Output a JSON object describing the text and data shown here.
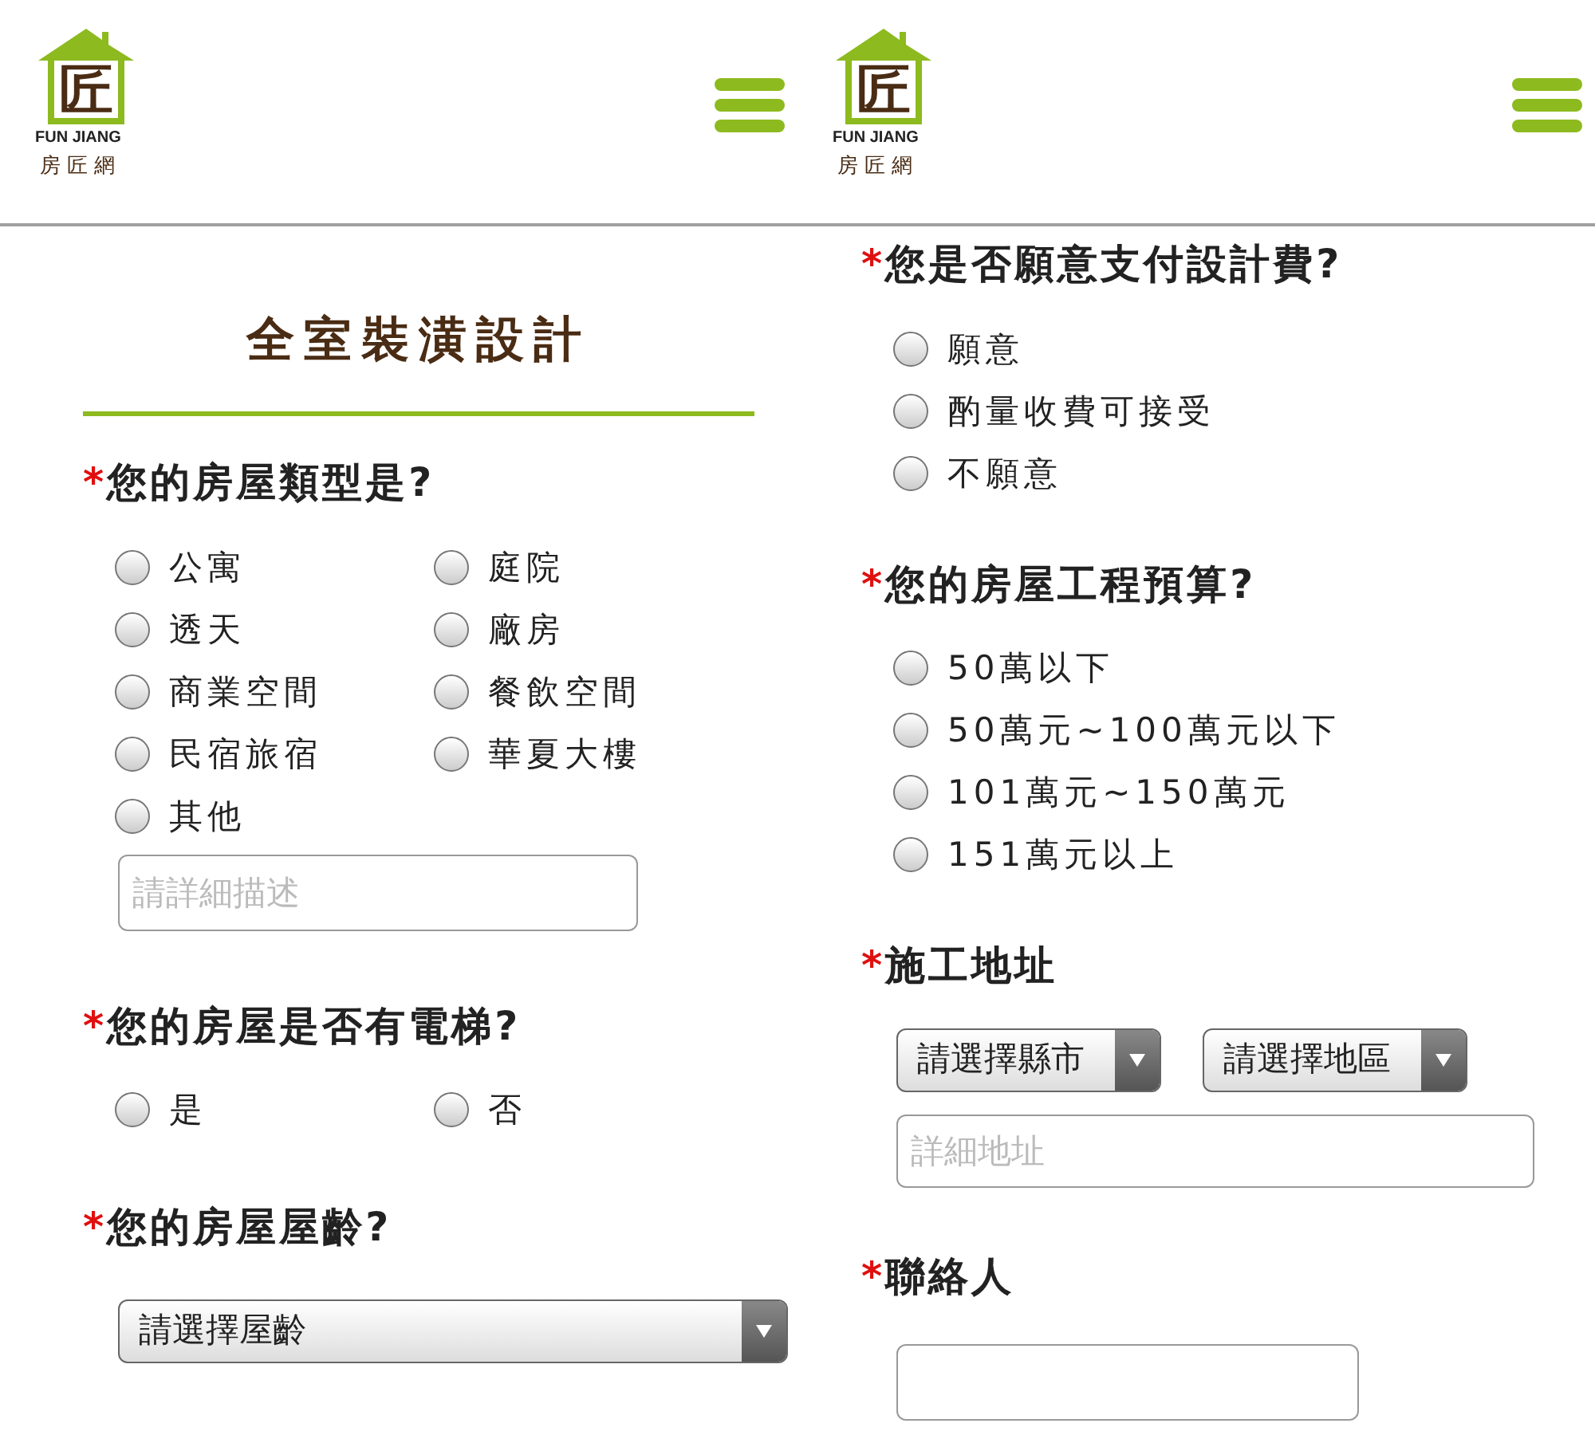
{
  "panels": [
    {
      "header": {
        "logo_char": "匠",
        "logo_en": "FUN JIANG",
        "logo_zh": "房匠網"
      },
      "title": "全室裝潢設計",
      "questions": [
        {
          "label": "您的房屋類型是?",
          "required_mark": "*",
          "fields": [
            {
              "kind": "radio-grid",
              "options": [
                {
                  "label": "公寓",
                  "selected": false
                },
                {
                  "label": "庭院",
                  "selected": false
                },
                {
                  "label": "透天",
                  "selected": false
                },
                {
                  "label": "廠房",
                  "selected": false
                },
                {
                  "label": "商業空間",
                  "selected": false
                },
                {
                  "label": "餐飲空間",
                  "selected": false
                },
                {
                  "label": "民宿旅宿",
                  "selected": false
                },
                {
                  "label": "華夏大樓",
                  "selected": false
                },
                {
                  "label": "其他",
                  "selected": false
                }
              ]
            },
            {
              "kind": "text-input",
              "placeholder": "請詳細描述"
            }
          ]
        },
        {
          "label": "您的房屋是否有電梯?",
          "required_mark": "*",
          "fields": [
            {
              "kind": "radio-grid",
              "options": [
                {
                  "label": "是",
                  "selected": false
                },
                {
                  "label": "否",
                  "selected": false
                }
              ]
            }
          ]
        },
        {
          "label": "您的房屋屋齡?",
          "required_mark": "*",
          "fields": [
            {
              "kind": "select",
              "value": "請選擇屋齡"
            }
          ]
        }
      ]
    },
    {
      "header": {
        "logo_char": "匠",
        "logo_en": "FUN JIANG",
        "logo_zh": "房匠網"
      },
      "questions": [
        {
          "label": "您是否願意支付設計費?",
          "required_mark": "*",
          "fields": [
            {
              "kind": "radio-list",
              "options": [
                {
                  "label": "願意",
                  "selected": false
                },
                {
                  "label": "酌量收費可接受",
                  "selected": false
                },
                {
                  "label": "不願意",
                  "selected": false
                }
              ]
            }
          ]
        },
        {
          "label": "您的房屋工程預算?",
          "required_mark": "*",
          "fields": [
            {
              "kind": "radio-list",
              "options": [
                {
                  "label": "50萬以下",
                  "selected": false
                },
                {
                  "label": "50萬元~100萬元以下",
                  "selected": false
                },
                {
                  "label": "101萬元~150萬元",
                  "selected": false
                },
                {
                  "label": "151萬元以上",
                  "selected": false
                }
              ]
            }
          ]
        },
        {
          "label": "施工地址",
          "required_mark": "*",
          "fields": [
            {
              "kind": "select-pair",
              "values": [
                "請選擇縣市",
                "請選擇地區"
              ]
            },
            {
              "kind": "text-input",
              "placeholder": "詳細地址"
            }
          ]
        },
        {
          "label": "聯絡人",
          "required_mark": "*",
          "fields": [
            {
              "kind": "text-input"
            }
          ]
        }
      ]
    }
  ]
}
